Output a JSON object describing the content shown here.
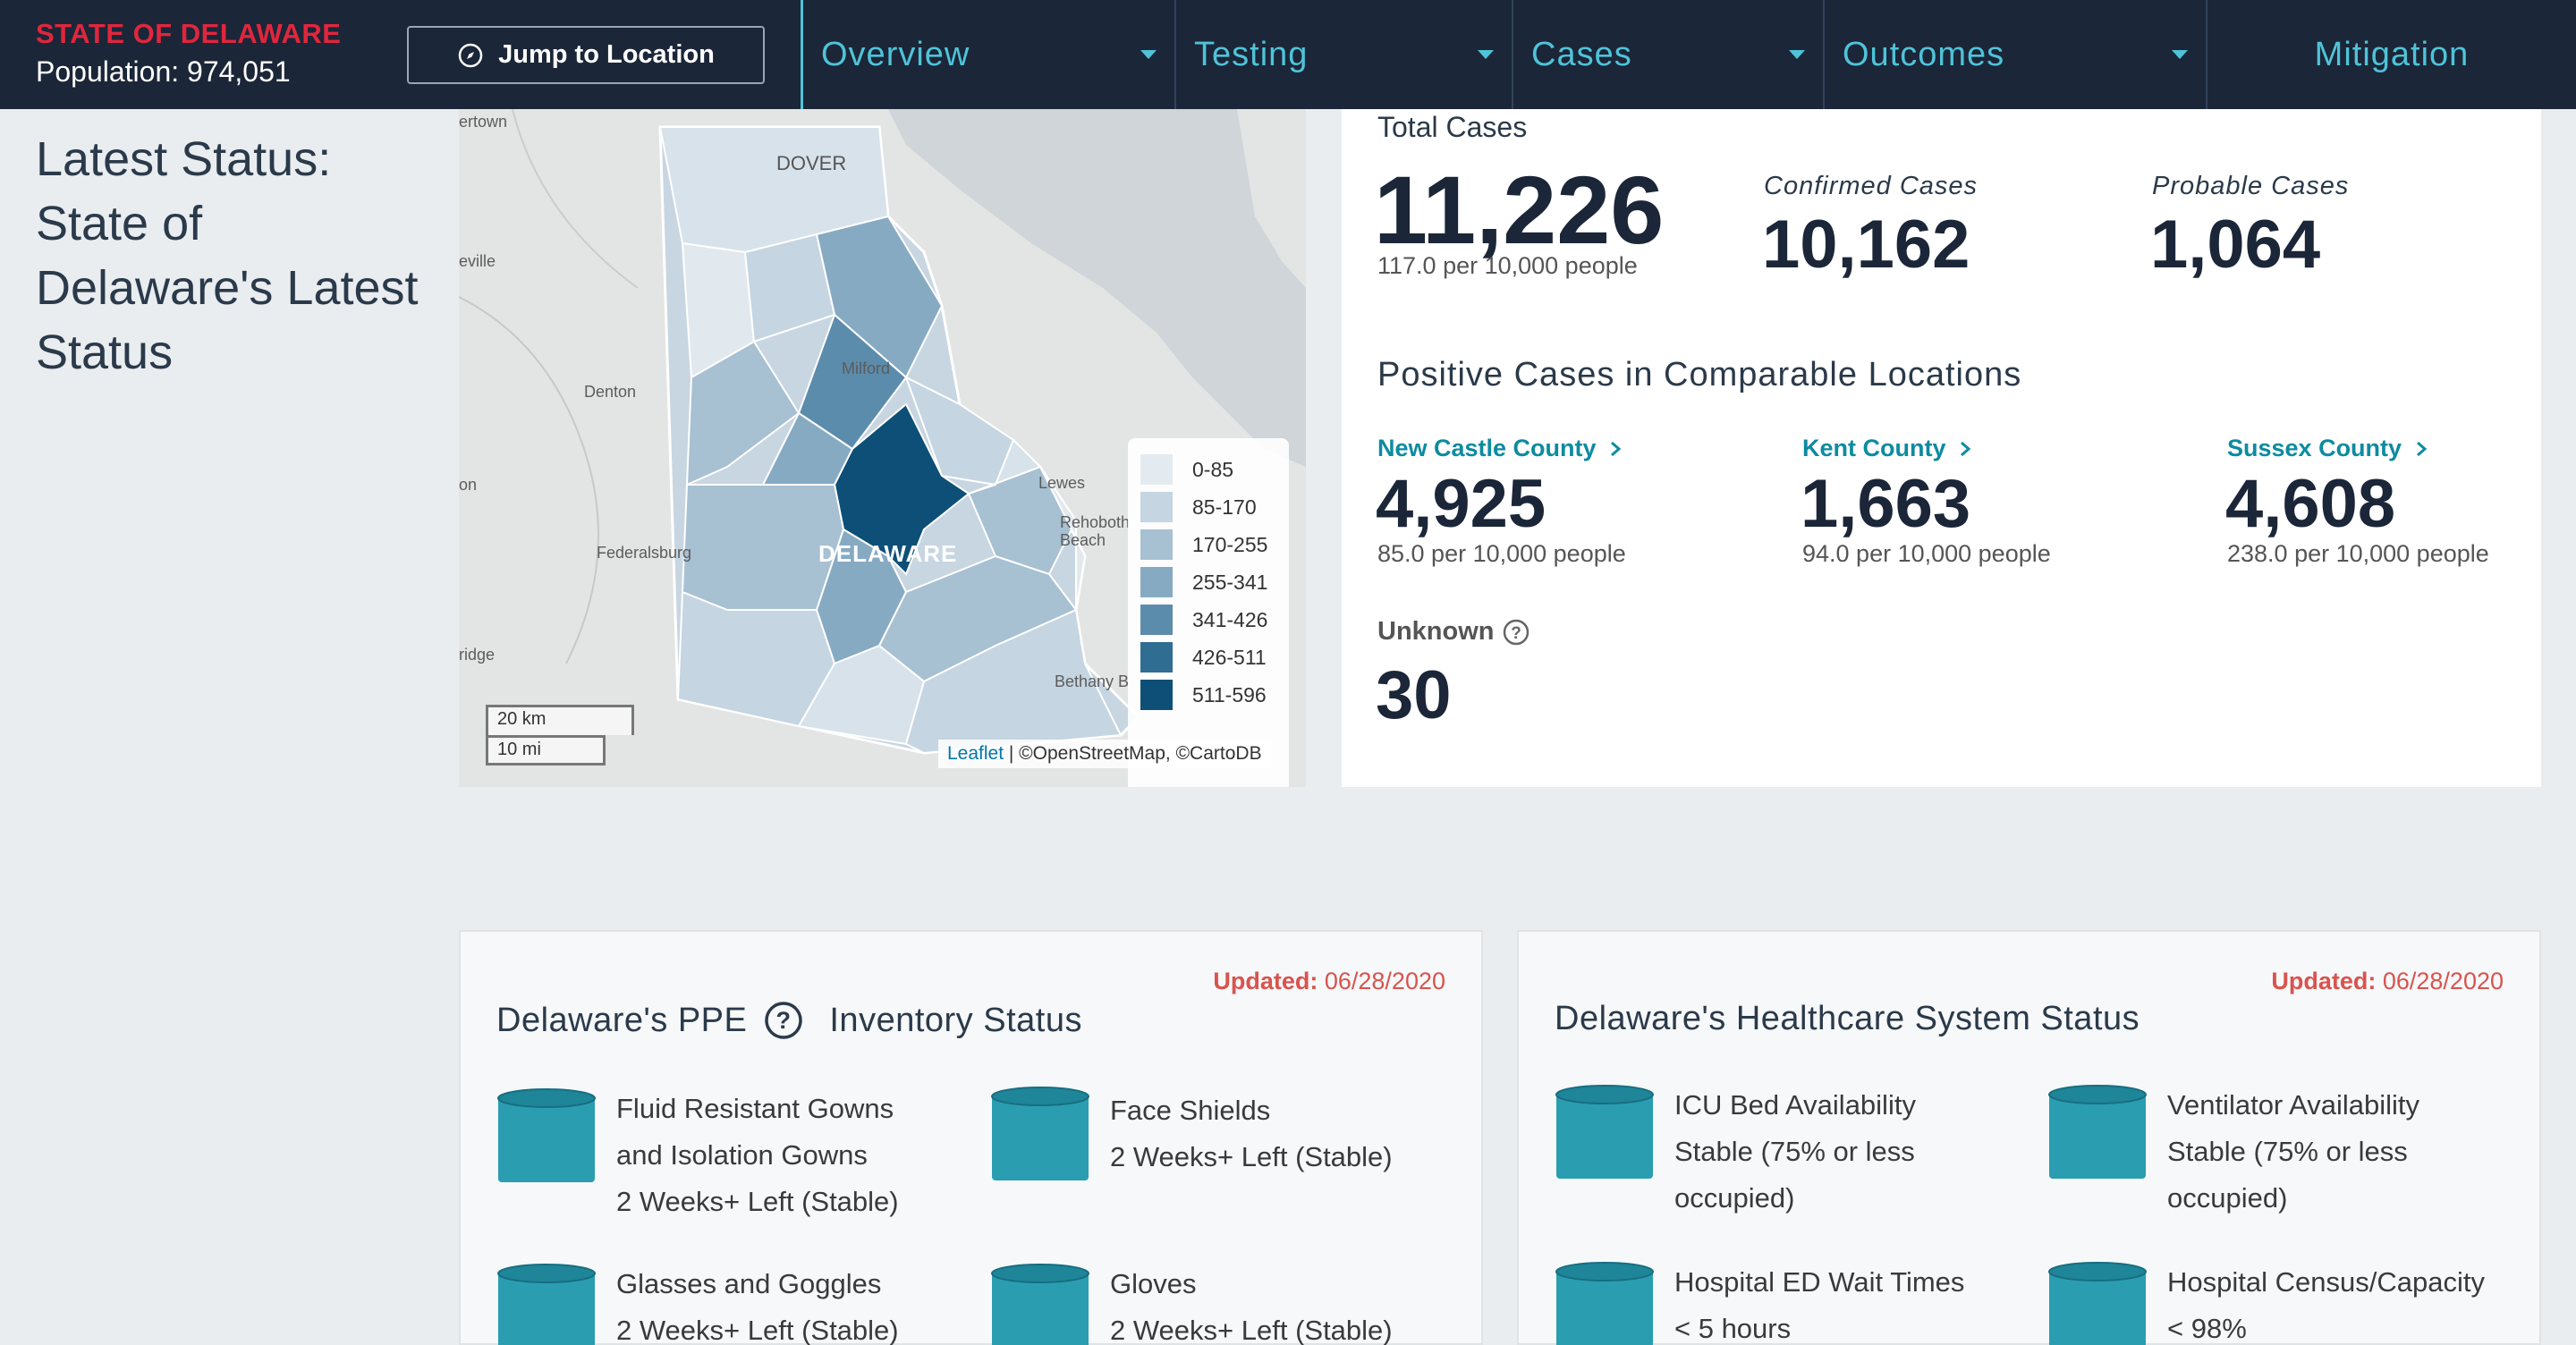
{
  "nav": {
    "state_title": "STATE OF DELAWARE",
    "population": "Population: 974,051",
    "jump_label": "Jump to Location",
    "tabs": [
      {
        "label": "Overview"
      },
      {
        "label": "Testing"
      },
      {
        "label": "Cases"
      },
      {
        "label": "Outcomes"
      },
      {
        "label": "Mitigation"
      }
    ]
  },
  "side_title": "Latest Status: State of Delaware's Latest Status",
  "map": {
    "place_labels": [
      "ertown",
      "DOVER",
      "eville",
      "Milford",
      "Denton",
      "on",
      "Lewes",
      "Rehoboth Beach",
      "Federalsburg",
      "DELAWARE",
      "ridge",
      "Bethany B"
    ],
    "legend": [
      {
        "range": "0-85",
        "color": "#e4ebf0"
      },
      {
        "range": "85-170",
        "color": "#c5d5e1"
      },
      {
        "range": "170-255",
        "color": "#a7c0d2"
      },
      {
        "range": "255-341",
        "color": "#87aac3"
      },
      {
        "range": "341-426",
        "color": "#5b8cac"
      },
      {
        "range": "426-511",
        "color": "#2f6d93"
      },
      {
        "range": "511-596",
        "color": "#0d4f77"
      }
    ],
    "scale_km": "20 km",
    "scale_mi": "10 mi",
    "attribution_link": "Leaflet",
    "attribution_rest": " | ©OpenStreetMap, ©CartoDB"
  },
  "cases": {
    "total_label": "Total Cases",
    "total_value": "11,226",
    "total_per": "117.0 per 10,000 people",
    "confirmed_label": "Confirmed Cases",
    "confirmed_value": "10,162",
    "probable_label": "Probable Cases",
    "probable_value": "1,064",
    "comparable_heading": "Positive Cases in Comparable Locations",
    "counties": [
      {
        "name": "New Castle County",
        "value": "4,925",
        "per": "85.0 per 10,000 people"
      },
      {
        "name": "Kent County",
        "value": "1,663",
        "per": "94.0 per 10,000 people"
      },
      {
        "name": "Sussex County",
        "value": "4,608",
        "per": "238.0 per 10,000 people"
      }
    ],
    "unknown_label": "Unknown",
    "unknown_value": "30"
  },
  "ppe": {
    "updated_label": "Updated:",
    "updated_date": "06/28/2020",
    "heading_a": "Delaware's PPE",
    "heading_b": "Inventory Status",
    "items": [
      {
        "line1": "Fluid Resistant Gowns",
        "line2": "and Isolation Gowns",
        "line3": "2 Weeks+ Left (Stable)"
      },
      {
        "line1": "Face Shields",
        "line2": "2 Weeks+ Left (Stable)"
      },
      {
        "line1": "Glasses and Goggles",
        "line2": "2 Weeks+ Left (Stable)"
      },
      {
        "line1": "Gloves",
        "line2": "2 Weeks+ Left (Stable)"
      }
    ]
  },
  "healthcare": {
    "updated_label": "Updated:",
    "updated_date": "06/28/2020",
    "heading": "Delaware's Healthcare System Status",
    "items": [
      {
        "line1": "ICU Bed Availability",
        "line2": "Stable (75% or less",
        "line3": "occupied)"
      },
      {
        "line1": "Ventilator Availability",
        "line2": "Stable (75% or less",
        "line3": "occupied)"
      },
      {
        "line1": "Hospital ED Wait Times",
        "line2": "< 5 hours"
      },
      {
        "line1": "Hospital Census/Capacity",
        "line2": "< 98%"
      }
    ]
  },
  "colors": {
    "nav_bg": "#1b2638",
    "accent_teal": "#4fc3d8",
    "brand_red": "#e0263d",
    "link_teal": "#0d8ba0",
    "can_teal": "#2a9db1",
    "updated_red": "#d9534f"
  }
}
